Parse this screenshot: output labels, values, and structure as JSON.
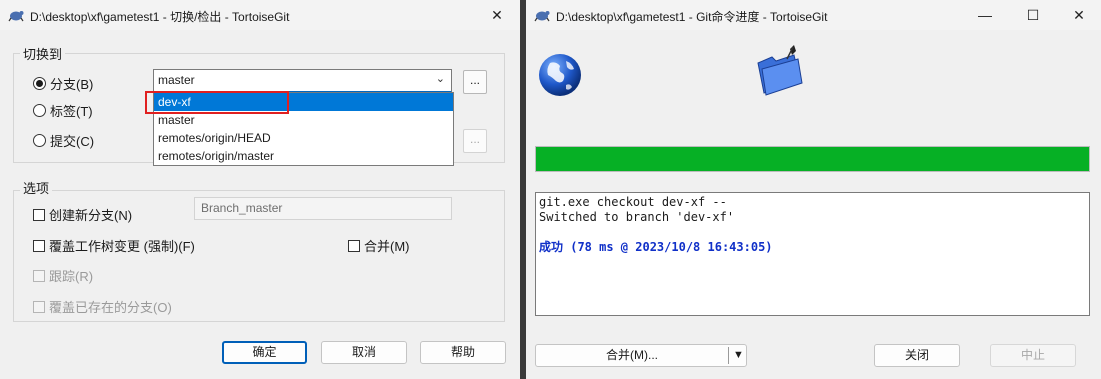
{
  "checkout_dialog": {
    "title": "D:\\desktop\\xf\\gametest1 - 切换/检出 - TortoiseGit",
    "close_glyph": "✕",
    "switch_to_group": "切换到",
    "radio_branch": "分支(B)",
    "radio_tag": "标签(T)",
    "radio_commit": "提交(C)",
    "branch_combo_value": "master",
    "browse_label": "...",
    "dropdown_options": [
      "dev-xf",
      "master",
      "remotes/origin/HEAD",
      "remotes/origin/master"
    ],
    "dropdown_selected": "dev-xf",
    "options_group": "选项",
    "create_new_branch": "创建新分支(N)",
    "new_branch_name": "Branch_master",
    "override_worktree": "覆盖工作树变更 (强制)(F)",
    "merge": "合并(M)",
    "track": "跟踪(R)",
    "override_existing_branch": "覆盖已存在的分支(O)",
    "ok_button": "确定",
    "cancel_button": "取消",
    "help_button": "帮助"
  },
  "progress_dialog": {
    "title": "D:\\desktop\\xf\\gametest1 - Git命令进度 - TortoiseGit",
    "minimize_glyph": "—",
    "maximize_glyph": "☐",
    "close_glyph": "✕",
    "progress_fraction": 1.0,
    "log_lines": [
      "git.exe checkout dev-xf --",
      "Switched to branch 'dev-xf'",
      ""
    ],
    "success_line": "成功 (78 ms @ 2023/10/8 16:43:05)",
    "merge_button": "合并(M)...",
    "merge_dropdown_glyph": "▼",
    "close_button": "关闭",
    "abort_button": "中止"
  },
  "colors": {
    "progress_fill": "#06b025",
    "selection": "#0078d7",
    "highlight_box": "#e02020",
    "success_text": "#1030c8"
  }
}
